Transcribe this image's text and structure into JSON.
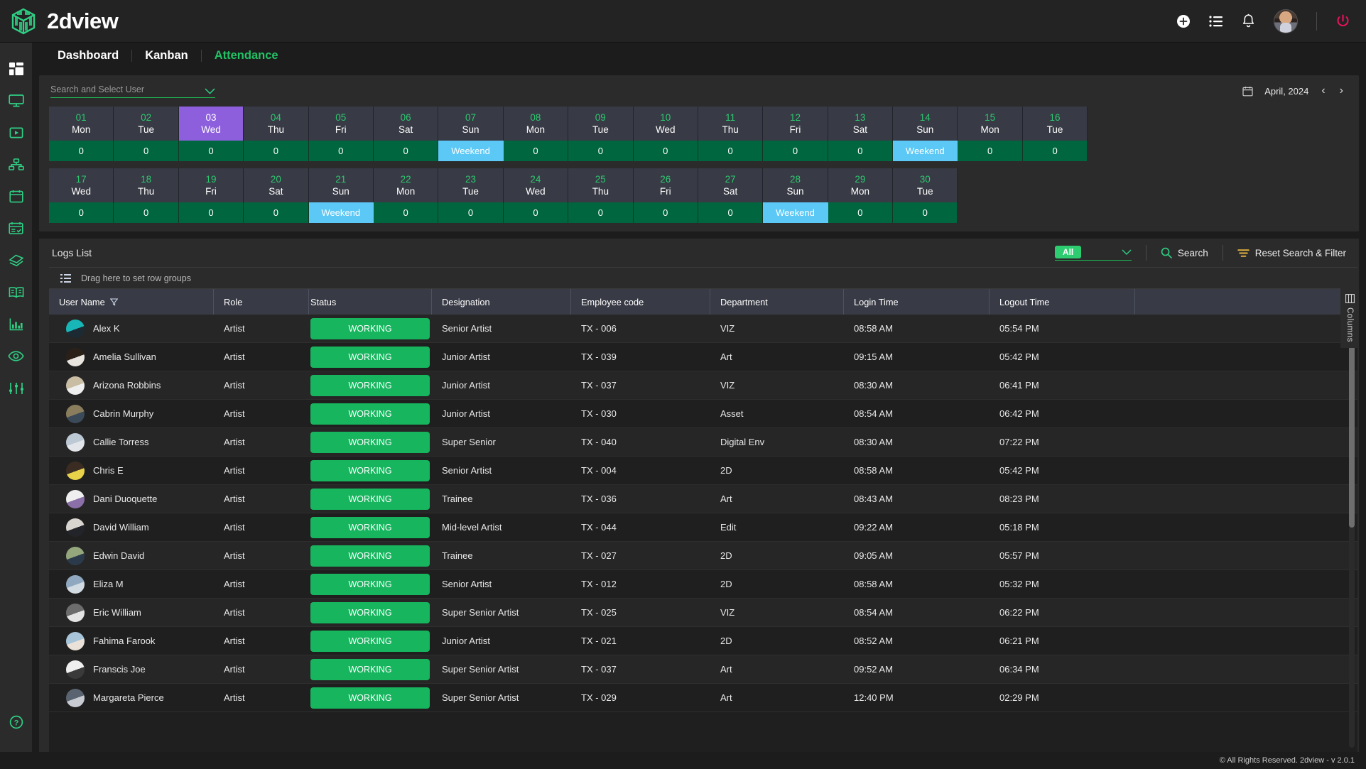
{
  "app": {
    "brand_name": "2dview",
    "footer_text": "© All Rights Reserved. 2dview - v 2.0.1"
  },
  "topbar": {
    "icons": [
      {
        "name": "add-circle-icon",
        "label": "Add"
      },
      {
        "name": "list-icon",
        "label": "List"
      },
      {
        "name": "bell-icon",
        "label": "Notifications"
      },
      {
        "name": "avatar",
        "label": "Profile"
      },
      {
        "name": "power-icon",
        "label": "Logout"
      }
    ]
  },
  "sidebar": {
    "items": [
      {
        "name": "dashboard-grid-icon",
        "label": "Dashboard"
      },
      {
        "name": "monitor-icon",
        "label": "Monitor"
      },
      {
        "name": "play-box-icon",
        "label": "Media"
      },
      {
        "name": "sitemap-icon",
        "label": "Hierarchy"
      },
      {
        "name": "calendar-icon",
        "label": "Calendar"
      },
      {
        "name": "calendar-check-icon",
        "label": "Attendance"
      },
      {
        "name": "tag-icon",
        "label": "Tags"
      },
      {
        "name": "book-icon",
        "label": "Library"
      },
      {
        "name": "bar-chart-icon",
        "label": "Reports"
      },
      {
        "name": "eye-icon",
        "label": "Review"
      },
      {
        "name": "sliders-icon",
        "label": "Settings"
      }
    ],
    "help_label": "Help"
  },
  "nav": {
    "tabs": [
      {
        "label": "Dashboard",
        "active": false
      },
      {
        "label": "Kanban",
        "active": false
      },
      {
        "label": "Attendance",
        "active": true
      }
    ]
  },
  "attendance": {
    "user_select_placeholder": "Search and Select User",
    "date_label": "April, 2024",
    "prev_label": "‹",
    "next_label": "›",
    "rows": [
      [
        {
          "num": "01",
          "day": "Mon",
          "value": "0",
          "selected": false,
          "weekend": false
        },
        {
          "num": "02",
          "day": "Tue",
          "value": "0",
          "selected": false,
          "weekend": false
        },
        {
          "num": "03",
          "day": "Wed",
          "value": "0",
          "selected": true,
          "weekend": false
        },
        {
          "num": "04",
          "day": "Thu",
          "value": "0",
          "selected": false,
          "weekend": false
        },
        {
          "num": "05",
          "day": "Fri",
          "value": "0",
          "selected": false,
          "weekend": false
        },
        {
          "num": "06",
          "day": "Sat",
          "value": "0",
          "selected": false,
          "weekend": false
        },
        {
          "num": "07",
          "day": "Sun",
          "value": "Weekend",
          "selected": false,
          "weekend": true
        },
        {
          "num": "08",
          "day": "Mon",
          "value": "0",
          "selected": false,
          "weekend": false
        },
        {
          "num": "09",
          "day": "Tue",
          "value": "0",
          "selected": false,
          "weekend": false
        },
        {
          "num": "10",
          "day": "Wed",
          "value": "0",
          "selected": false,
          "weekend": false
        },
        {
          "num": "11",
          "day": "Thu",
          "value": "0",
          "selected": false,
          "weekend": false
        },
        {
          "num": "12",
          "day": "Fri",
          "value": "0",
          "selected": false,
          "weekend": false
        },
        {
          "num": "13",
          "day": "Sat",
          "value": "0",
          "selected": false,
          "weekend": false
        },
        {
          "num": "14",
          "day": "Sun",
          "value": "Weekend",
          "selected": false,
          "weekend": true
        },
        {
          "num": "15",
          "day": "Mon",
          "value": "0",
          "selected": false,
          "weekend": false
        },
        {
          "num": "16",
          "day": "Tue",
          "value": "0",
          "selected": false,
          "weekend": false
        }
      ],
      [
        {
          "num": "17",
          "day": "Wed",
          "value": "0",
          "selected": false,
          "weekend": false
        },
        {
          "num": "18",
          "day": "Thu",
          "value": "0",
          "selected": false,
          "weekend": false
        },
        {
          "num": "19",
          "day": "Fri",
          "value": "0",
          "selected": false,
          "weekend": false
        },
        {
          "num": "20",
          "day": "Sat",
          "value": "0",
          "selected": false,
          "weekend": false
        },
        {
          "num": "21",
          "day": "Sun",
          "value": "Weekend",
          "selected": false,
          "weekend": true
        },
        {
          "num": "22",
          "day": "Mon",
          "value": "0",
          "selected": false,
          "weekend": false
        },
        {
          "num": "23",
          "day": "Tue",
          "value": "0",
          "selected": false,
          "weekend": false
        },
        {
          "num": "24",
          "day": "Wed",
          "value": "0",
          "selected": false,
          "weekend": false
        },
        {
          "num": "25",
          "day": "Thu",
          "value": "0",
          "selected": false,
          "weekend": false
        },
        {
          "num": "26",
          "day": "Fri",
          "value": "0",
          "selected": false,
          "weekend": false
        },
        {
          "num": "27",
          "day": "Sat",
          "value": "0",
          "selected": false,
          "weekend": false
        },
        {
          "num": "28",
          "day": "Sun",
          "value": "Weekend",
          "selected": false,
          "weekend": true
        },
        {
          "num": "29",
          "day": "Mon",
          "value": "0",
          "selected": false,
          "weekend": false
        },
        {
          "num": "30",
          "day": "Tue",
          "value": "0",
          "selected": false,
          "weekend": false
        }
      ]
    ]
  },
  "logs": {
    "title": "Logs List",
    "filter_value": "All",
    "search_label": "Search",
    "reset_label": "Reset Search & Filter",
    "rowgroup_hint": "Drag here to set row groups",
    "columns_tab_label": "Columns",
    "columns": [
      "User Name",
      "Role",
      "Status",
      "Designation",
      "Employee code",
      "Department",
      "Login Time",
      "Logout Time"
    ],
    "rows": [
      {
        "user": "Alex K",
        "role": "Artist",
        "status": "WORKING",
        "designation": "Senior Artist",
        "code": "TX - 006",
        "dept": "VIZ",
        "in": "08:58 AM",
        "out": "05:54 PM",
        "av1": "#18b6b6",
        "av2": "#1c2a33"
      },
      {
        "user": "Amelia Sullivan",
        "role": "Artist",
        "status": "WORKING",
        "designation": "Junior Artist",
        "code": "TX - 039",
        "dept": "Art",
        "in": "09:15 AM",
        "out": "05:42 PM",
        "av1": "#2a2018",
        "av2": "#e8e4de"
      },
      {
        "user": "Arizona Robbins",
        "role": "Artist",
        "status": "WORKING",
        "designation": "Junior Artist",
        "code": "TX - 037",
        "dept": "VIZ",
        "in": "08:30 AM",
        "out": "06:41 PM",
        "av1": "#c9bda4",
        "av2": "#efefef"
      },
      {
        "user": "Cabrin Murphy",
        "role": "Artist",
        "status": "WORKING",
        "designation": "Junior Artist",
        "code": "TX - 030",
        "dept": "Asset",
        "in": "08:54 AM",
        "out": "06:42 PM",
        "av1": "#8a7d5e",
        "av2": "#3a4a58"
      },
      {
        "user": "Callie Torress",
        "role": "Artist",
        "status": "WORKING",
        "designation": "Super Senior",
        "code": "TX - 040",
        "dept": "Digital Env",
        "in": "08:30 AM",
        "out": "07:22 PM",
        "av1": "#bcc8d4",
        "av2": "#e2e6ea"
      },
      {
        "user": "Chris E",
        "role": "Artist",
        "status": "WORKING",
        "designation": "Senior Artist",
        "code": "TX - 004",
        "dept": "2D",
        "in": "08:58 AM",
        "out": "05:42 PM",
        "av1": "#3a2c22",
        "av2": "#e8d24a"
      },
      {
        "user": "Dani Duoquette",
        "role": "Artist",
        "status": "WORKING",
        "designation": "Trainee",
        "code": "TX - 036",
        "dept": "Art",
        "in": "08:43 AM",
        "out": "08:23 PM",
        "av1": "#efefef",
        "av2": "#8a6fa8"
      },
      {
        "user": "David William",
        "role": "Artist",
        "status": "WORKING",
        "designation": "Mid-level Artist",
        "code": "TX - 044",
        "dept": "Edit",
        "in": "09:22 AM",
        "out": "05:18 PM",
        "av1": "#d8d4cf",
        "av2": "#22242a"
      },
      {
        "user": "Edwin David",
        "role": "Artist",
        "status": "WORKING",
        "designation": "Trainee",
        "code": "TX - 027",
        "dept": "2D",
        "in": "09:05 AM",
        "out": "05:57 PM",
        "av1": "#93a67c",
        "av2": "#2b3a4a"
      },
      {
        "user": "Eliza M",
        "role": "Artist",
        "status": "WORKING",
        "designation": "Senior Artist",
        "code": "TX - 012",
        "dept": "2D",
        "in": "08:58 AM",
        "out": "05:32 PM",
        "av1": "#8fa8bf",
        "av2": "#d2dae2"
      },
      {
        "user": "Eric William",
        "role": "Artist",
        "status": "WORKING",
        "designation": "Super Senior Artist",
        "code": "TX - 025",
        "dept": "VIZ",
        "in": "08:54 AM",
        "out": "06:22 PM",
        "av1": "#6c6c6c",
        "av2": "#e4e4e4"
      },
      {
        "user": "Fahima Farook",
        "role": "Artist",
        "status": "WORKING",
        "designation": "Junior Artist",
        "code": "TX - 021",
        "dept": "2D",
        "in": "08:52 AM",
        "out": "06:21 PM",
        "av1": "#a8c4d8",
        "av2": "#eae2d8"
      },
      {
        "user": "Franscis Joe",
        "role": "Artist",
        "status": "WORKING",
        "designation": "Super Senior Artist",
        "code": "TX - 037",
        "dept": "Art",
        "in": "09:52 AM",
        "out": "06:34 PM",
        "av1": "#efefef",
        "av2": "#3a3a3a"
      },
      {
        "user": "Margareta Pierce",
        "role": "Artist",
        "status": "WORKING",
        "designation": "Super Senior Artist",
        "code": "TX - 029",
        "dept": "Art",
        "in": "12:40 PM",
        "out": "02:29 PM",
        "av1": "#5a6470",
        "av2": "#c8ccd2"
      }
    ]
  },
  "colors": {
    "accent_green": "#22c265",
    "status_green": "#17b55e",
    "weekend_blue": "#5bc8f5",
    "selected_purple": "#8d5fdd",
    "cell_green": "#00663f",
    "power_red": "#e8125c"
  }
}
